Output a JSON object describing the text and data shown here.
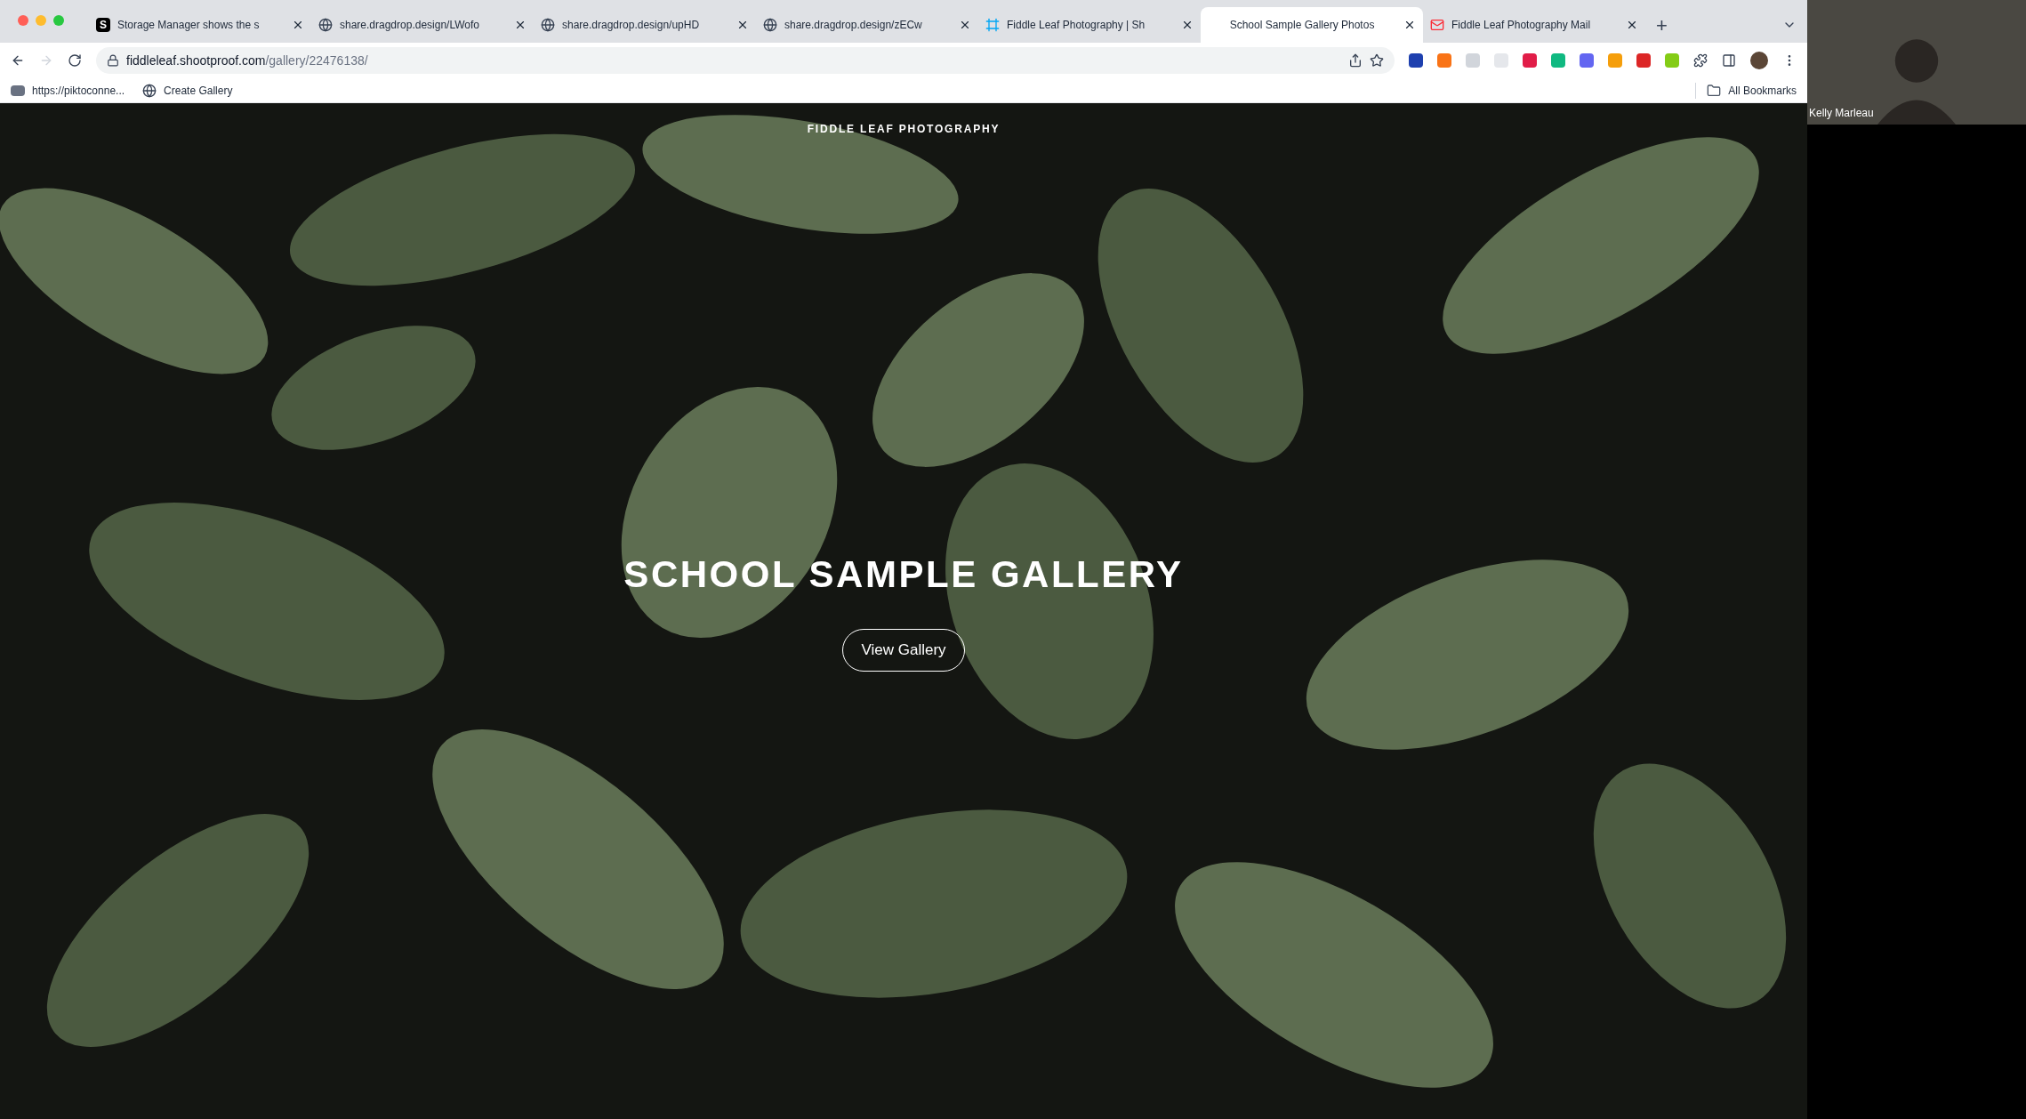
{
  "browser": {
    "tabs": [
      {
        "title": "Storage Manager shows the s",
        "kind": "letter",
        "favicon_text": "S",
        "selected": false
      },
      {
        "title": "share.dragdrop.design/LWofo",
        "kind": "globe",
        "selected": false
      },
      {
        "title": "share.dragdrop.design/upHD",
        "kind": "globe",
        "selected": false
      },
      {
        "title": "share.dragdrop.design/zECw",
        "kind": "globe",
        "selected": false
      },
      {
        "title": "Fiddle Leaf Photography | Sh",
        "kind": "frame",
        "selected": false
      },
      {
        "title": "School Sample Gallery Photos",
        "kind": "none",
        "selected": true
      },
      {
        "title": "Fiddle Leaf Photography Mail",
        "kind": "mail",
        "selected": false
      }
    ],
    "new_tab": "+",
    "address": {
      "host": "fiddleleaf.shootproof.com",
      "path": "/gallery/22476138/"
    },
    "bookmarks": [
      {
        "label": "https://piktoconne...",
        "kind": "app"
      },
      {
        "label": "Create Gallery",
        "kind": "globe"
      }
    ],
    "all_bookmarks": "All Bookmarks"
  },
  "page": {
    "brand": "FIDDLE LEAF PHOTOGRAPHY",
    "heading": "SCHOOL SAMPLE GALLERY",
    "button": "View Gallery"
  },
  "video_call": {
    "participant": "Kelly Marleau"
  }
}
